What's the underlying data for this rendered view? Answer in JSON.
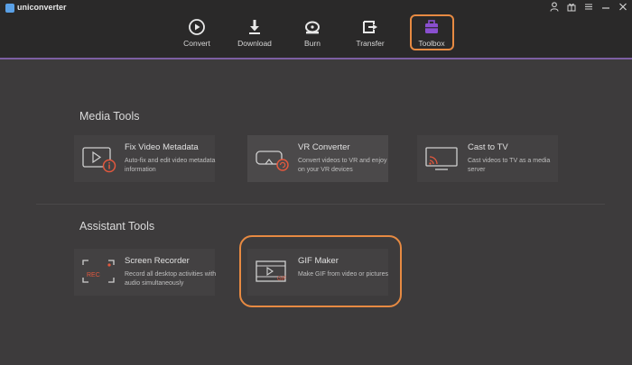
{
  "app": {
    "title": "uniconverter"
  },
  "nav": {
    "items": [
      {
        "label": "Convert",
        "icon": "convert-icon"
      },
      {
        "label": "Download",
        "icon": "download-icon"
      },
      {
        "label": "Burn",
        "icon": "burn-icon"
      },
      {
        "label": "Transfer",
        "icon": "transfer-icon"
      },
      {
        "label": "Toolbox",
        "icon": "toolbox-icon",
        "active": true
      }
    ]
  },
  "colors": {
    "accent": "#e78a42",
    "nav_line": "#7d5fa3",
    "background": "#3d3b3c",
    "bar": "#2a2929"
  },
  "sections": {
    "media": {
      "title": "Media Tools",
      "cards": [
        {
          "title": "Fix Video Metadata",
          "desc": "Auto-fix and edit video metadata information",
          "icon": "video-metadata-icon"
        },
        {
          "title": "VR Converter",
          "desc": "Convert videos to VR and enjoy on your VR devices",
          "icon": "vr-headset-icon"
        },
        {
          "title": "Cast to TV",
          "desc": "Cast videos to TV as a media server",
          "icon": "cast-tv-icon"
        }
      ]
    },
    "assistant": {
      "title": "Assistant Tools",
      "cards": [
        {
          "title": "Screen Recorder",
          "desc": "Record all desktop activities with audio simultaneously",
          "icon": "screen-recorder-icon",
          "badge": "REC"
        },
        {
          "title": "GIF Maker",
          "desc": "Make GIF from video or pictures",
          "icon": "gif-maker-icon",
          "badge": "GIF"
        }
      ]
    }
  }
}
